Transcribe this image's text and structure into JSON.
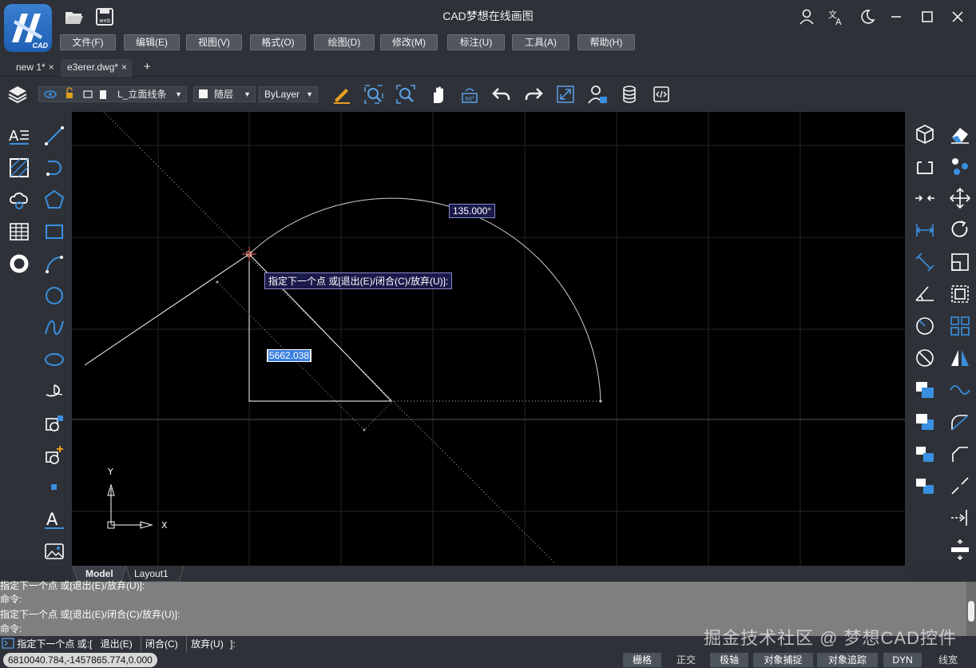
{
  "app": {
    "title": "CAD梦想在线画图",
    "logo_text": "CAD"
  },
  "menu": [
    "文件(F)",
    "编辑(E)",
    "视图(V)",
    "格式(O)",
    "绘图(D)",
    "修改(M)",
    "标注(U)",
    "工具(A)",
    "帮助(H)"
  ],
  "doc_tabs": [
    {
      "label": "new 1*",
      "close": "×"
    },
    {
      "label": "e3erer.dwg*",
      "close": "×"
    }
  ],
  "add_tab": "+",
  "toolbar": {
    "layer_name": "L_立面线条",
    "color": "随层",
    "linetype": "ByLayer"
  },
  "canvas": {
    "angle_label": "135.000°",
    "prompt_label": "指定下一个点 或[退出(E)/闭合(C)/放弃(U)]:",
    "distance_value": "5662.038",
    "ucs_y": "Y",
    "ucs_x": "X"
  },
  "layout_tabs": [
    "Model",
    "Layout1"
  ],
  "command_history": [
    "指定下一个点 或[退出(E)/放弃(U)]:",
    "命令:",
    "指定下一个点 或[退出(E)/闭合(C)/放弃(U)]:",
    "命令:"
  ],
  "command_line": {
    "prompt": "指定下一个点 或:[",
    "options": [
      "退出(E)",
      "闭合(C)",
      "放弃(U)"
    ],
    "end": "]:"
  },
  "watermark": "掘金技术社区 @ 梦想CAD控件",
  "status": {
    "coords": "6810040.784,-1457865.774,0.000",
    "buttons": [
      {
        "label": "栅格",
        "on": true
      },
      {
        "label": "正交",
        "on": false
      },
      {
        "label": "极轴",
        "on": true
      },
      {
        "label": "对象捕捉",
        "on": true
      },
      {
        "label": "对象追踪",
        "on": true
      },
      {
        "label": "DYN",
        "on": true
      },
      {
        "label": "线宽",
        "on": false
      }
    ]
  },
  "colors": {
    "chrome": "#2e3238",
    "canvas": "#000000",
    "accent": "#3a7fd0",
    "command_bg": "#7f7f7f"
  }
}
